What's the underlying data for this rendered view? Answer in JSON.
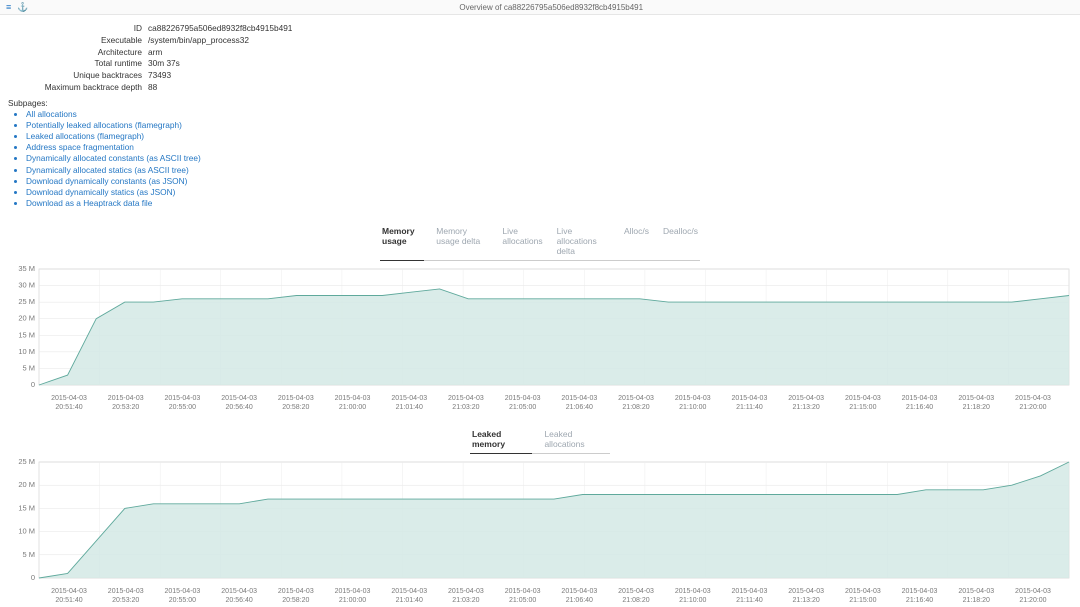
{
  "header": {
    "title": "Overview of ca88226795a506ed8932f8cb4915b491",
    "icons": {
      "menu": "≡",
      "anchor": "⚓"
    }
  },
  "meta": {
    "labels": {
      "id": "ID",
      "executable": "Executable",
      "architecture": "Architecture",
      "total_runtime": "Total runtime",
      "unique_backtraces": "Unique backtraces",
      "max_backtrace_depth": "Maximum backtrace depth"
    },
    "values": {
      "id": "ca88226795a506ed8932f8cb4915b491",
      "executable": "/system/bin/app_process32",
      "architecture": "arm",
      "total_runtime": "30m 37s",
      "unique_backtraces": "73493",
      "max_backtrace_depth": "88"
    }
  },
  "subpages": {
    "title": "Subpages:",
    "items": [
      "All allocations",
      "Potentially leaked allocations (flamegraph)",
      "Leaked allocations (flamegraph)",
      "Address space fragmentation",
      "Dynamically allocated constants (as ASCII tree)",
      "Dynamically allocated statics (as ASCII tree)",
      "Download dynamically constants (as JSON)",
      "Download dynamically statics (as JSON)",
      "Download as a Heaptrack data file"
    ]
  },
  "tabs_top": [
    "Memory usage",
    "Memory usage delta",
    "Live allocations",
    "Live allocations delta",
    "Alloc/s",
    "Dealloc/s"
  ],
  "tabs_top_active": 0,
  "tabs_bottom": [
    "Leaked memory",
    "Leaked allocations"
  ],
  "tabs_bottom_active": 0,
  "chart_data": [
    {
      "type": "area",
      "title": "Memory usage",
      "ylabel": "",
      "xlabel": "",
      "ylim": [
        0,
        35
      ],
      "yticks": [
        0,
        "5 M",
        "10 M",
        "15 M",
        "20 M",
        "25 M",
        "30 M",
        "35 M"
      ],
      "x_dates": [
        "2015-04-03",
        "2015-04-03",
        "2015-04-03",
        "2015-04-03",
        "2015-04-03",
        "2015-04-03",
        "2015-04-03",
        "2015-04-03",
        "2015-04-03",
        "2015-04-03",
        "2015-04-03",
        "2015-04-03",
        "2015-04-03",
        "2015-04-03",
        "2015-04-03",
        "2015-04-03",
        "2015-04-03",
        "2015-04-03"
      ],
      "x_times": [
        "20:51:40",
        "20:53:20",
        "20:55:00",
        "20:56:40",
        "20:58:20",
        "21:00:00",
        "21:01:40",
        "21:03:20",
        "21:05:00",
        "21:06:40",
        "21:08:20",
        "21:10:00",
        "21:11:40",
        "21:13:20",
        "21:15:00",
        "21:16:40",
        "21:18:20",
        "21:20:00"
      ],
      "values": [
        0,
        3,
        20,
        25,
        25,
        26,
        26,
        26,
        26,
        27,
        27,
        27,
        27,
        28,
        29,
        26,
        26,
        26,
        26,
        26,
        26,
        26,
        25,
        25,
        25,
        25,
        25,
        25,
        25,
        25,
        25,
        25,
        25,
        25,
        25,
        26,
        27
      ]
    },
    {
      "type": "area",
      "title": "Leaked memory",
      "ylabel": "",
      "xlabel": "",
      "ylim": [
        0,
        25
      ],
      "yticks": [
        0,
        "5 M",
        "10 M",
        "15 M",
        "20 M",
        "25 M"
      ],
      "x_dates": [
        "2015-04-03",
        "2015-04-03",
        "2015-04-03",
        "2015-04-03",
        "2015-04-03",
        "2015-04-03",
        "2015-04-03",
        "2015-04-03",
        "2015-04-03",
        "2015-04-03",
        "2015-04-03",
        "2015-04-03",
        "2015-04-03",
        "2015-04-03",
        "2015-04-03",
        "2015-04-03",
        "2015-04-03",
        "2015-04-03"
      ],
      "x_times": [
        "20:51:40",
        "20:53:20",
        "20:55:00",
        "20:56:40",
        "20:58:20",
        "21:00:00",
        "21:01:40",
        "21:03:20",
        "21:05:00",
        "21:06:40",
        "21:08:20",
        "21:10:00",
        "21:11:40",
        "21:13:20",
        "21:15:00",
        "21:16:40",
        "21:18:20",
        "21:20:00"
      ],
      "values": [
        0,
        1,
        8,
        15,
        16,
        16,
        16,
        16,
        17,
        17,
        17,
        17,
        17,
        17,
        17,
        17,
        17,
        17,
        17,
        18,
        18,
        18,
        18,
        18,
        18,
        18,
        18,
        18,
        18,
        18,
        18,
        19,
        19,
        19,
        20,
        22,
        25
      ]
    }
  ]
}
